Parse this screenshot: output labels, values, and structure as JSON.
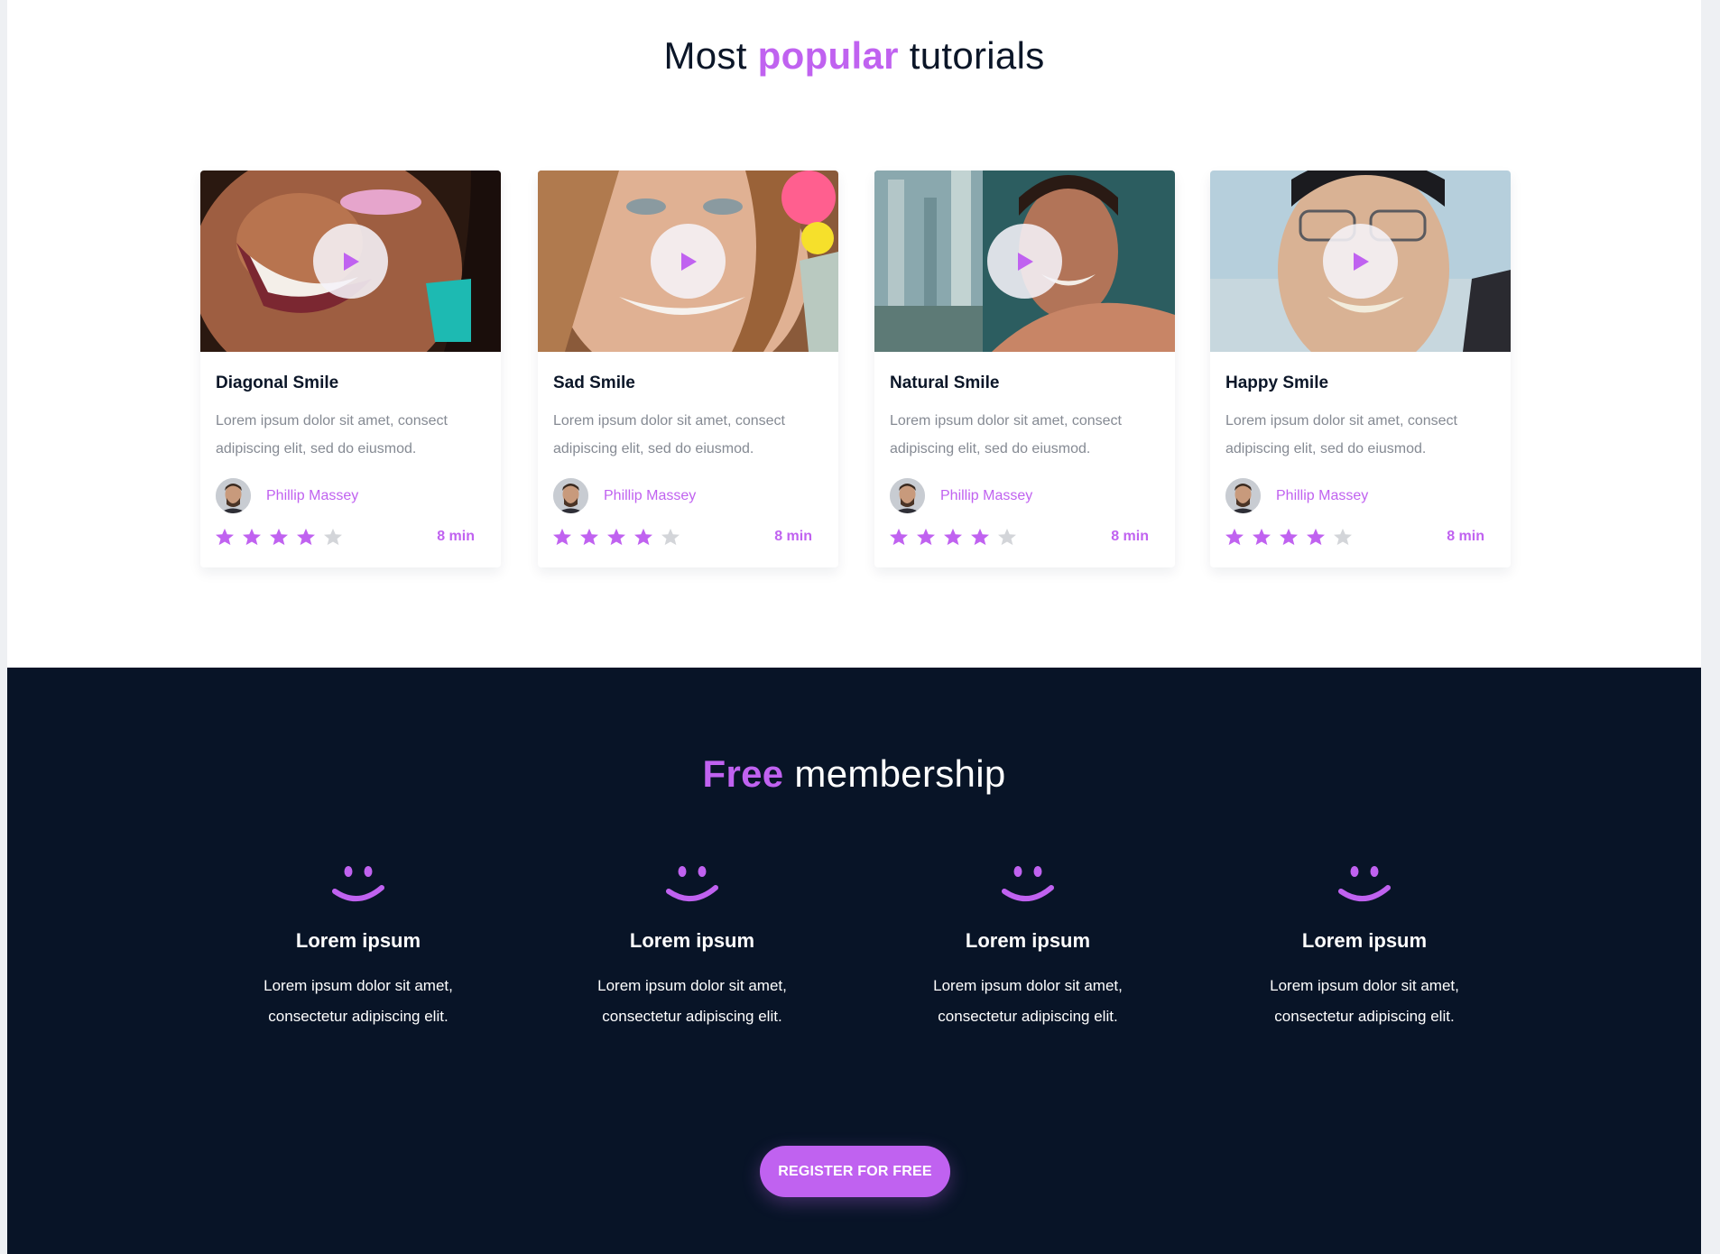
{
  "tutorials": {
    "title_pre": "Most",
    "title_accent": "popular",
    "title_post": "tutorials",
    "cards": [
      {
        "title": "Diagonal Smile",
        "desc": "Lorem ipsum dolor sit amet, consect adipiscing elit, sed do eiusmod.",
        "author": "Phillip Massey",
        "duration": "8 min",
        "rating": 4,
        "max_rating": 5,
        "photo_colors": [
          "#3a1c12",
          "#a86648",
          "#1dbab2"
        ]
      },
      {
        "title": "Sad Smile",
        "desc": "Lorem ipsum dolor sit amet, consect adipiscing elit, sed do eiusmod.",
        "author": "Phillip Massey",
        "duration": "8 min",
        "rating": 4,
        "max_rating": 5,
        "photo_colors": [
          "#b9825c",
          "#e3b497",
          "#ff5f8f"
        ]
      },
      {
        "title": "Natural Smile",
        "desc": "Lorem ipsum dolor sit amet, consect adipiscing elit, sed do eiusmod.",
        "author": "Phillip Massey",
        "duration": "8 min",
        "rating": 4,
        "max_rating": 5,
        "photo_colors": [
          "#6b8e96",
          "#2d6a6a",
          "#b27458"
        ]
      },
      {
        "title": "Happy Smile",
        "desc": "Lorem ipsum dolor sit amet, consect adipiscing elit, sed do eiusmod.",
        "author": "Phillip Massey",
        "duration": "8 min",
        "rating": 4,
        "max_rating": 5,
        "photo_colors": [
          "#b6cfdc",
          "#d9b294",
          "#1b1b1f"
        ]
      }
    ]
  },
  "membership": {
    "title_accent": "Free",
    "title_post": "membership",
    "features": [
      {
        "title": "Lorem ipsum",
        "desc": "Lorem ipsum dolor sit amet, consectetur adipiscing elit.",
        "icon": "smile-icon"
      },
      {
        "title": "Lorem ipsum",
        "desc": "Lorem ipsum dolor sit amet, consectetur adipiscing elit.",
        "icon": "smile-icon"
      },
      {
        "title": "Lorem ipsum",
        "desc": "Lorem ipsum dolor sit amet, consectetur adipiscing elit.",
        "icon": "smile-icon"
      },
      {
        "title": "Lorem ipsum",
        "desc": "Lorem ipsum dolor sit amet, consectetur adipiscing elit.",
        "icon": "smile-icon"
      }
    ],
    "cta": "REGISTER FOR FREE"
  },
  "colors": {
    "accent": "#c062f0",
    "dark": "#081427",
    "star_empty": "#d3d5d9"
  }
}
